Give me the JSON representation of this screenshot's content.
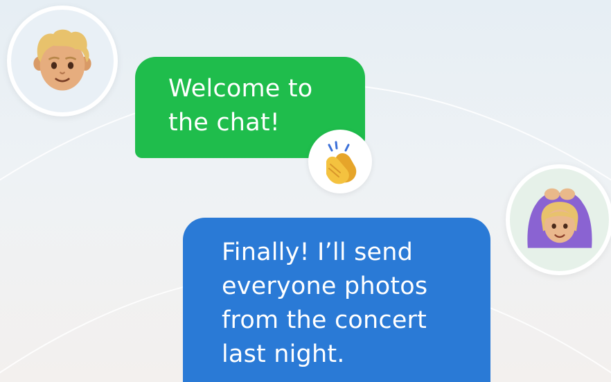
{
  "colors": {
    "background": "#e9eff3",
    "incoming_bubble": "#1fbd4c",
    "outgoing_bubble": "#2a7ad6",
    "bubble_text": "#ffffff",
    "avatar_border": "#ffffff"
  },
  "chat": {
    "messages": [
      {
        "sender_avatar": "blond-boy-emoji-icon",
        "lines": [
          "Welcome to",
          "the chat!"
        ],
        "reaction": "clapping-hands-icon"
      },
      {
        "sender_avatar": "woman-gesturing-ok-emoji-icon",
        "lines": [
          "Finally! I’ll send",
          "everyone photos",
          "from the concert",
          "last night."
        ]
      }
    ]
  }
}
